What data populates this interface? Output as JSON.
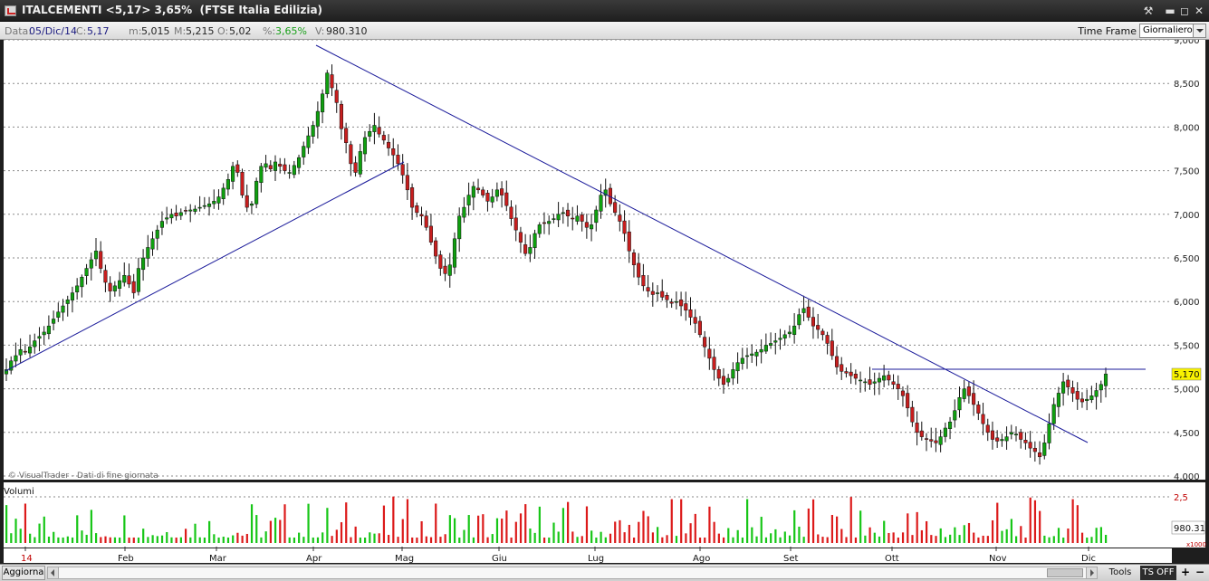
{
  "window": {
    "title": "ITALCEMENTI <5,17> 3,65%  (FTSE Italia Edilizia)",
    "icon": "chart-app-icon",
    "controls": [
      "tools-icon",
      "minimize-icon",
      "maximize-icon",
      "close-icon"
    ]
  },
  "infobar": {
    "date_label": "Data:",
    "date_value": "05/Dic/14",
    "close_label": "C:",
    "close_value": "5,17",
    "min_label": "m:",
    "min_value": "5,015",
    "max_label": "M:",
    "max_value": "5,215",
    "open_label": "O:",
    "open_value": "5,02",
    "pct_label": "%:",
    "pct_value": "3,65%",
    "vol_label": "V:",
    "vol_value": "980.310",
    "timeframe_label": "Time Frame",
    "timeframe_value": "Giornaliero"
  },
  "chart_data": [
    {
      "type": "candlestick",
      "yaxis": [
        "9,000",
        "8,500",
        "8,000",
        "7,500",
        "7,000",
        "6,500",
        "6,000",
        "5,500",
        "5,000",
        "4,500",
        "4,000"
      ],
      "ylim": [
        4.0,
        9.0
      ],
      "last_price": "5,170",
      "watermark": "© VisualTrader - Dati di fine giornata",
      "x_labels": [
        "14",
        "Feb",
        "Mar",
        "Apr",
        "Mag",
        "Giu",
        "Lug",
        "Ago",
        "Set",
        "Ott",
        "Nov",
        "Dic"
      ],
      "closes": [
        5.22,
        5.32,
        5.38,
        5.45,
        5.42,
        5.48,
        5.55,
        5.6,
        5.65,
        5.72,
        5.8,
        5.88,
        5.95,
        6.02,
        6.1,
        6.18,
        6.28,
        6.38,
        6.48,
        6.58,
        6.38,
        6.22,
        6.12,
        6.18,
        6.24,
        6.3,
        6.2,
        6.1,
        6.38,
        6.5,
        6.62,
        6.72,
        6.82,
        6.92,
        6.96,
        7.0,
        6.98,
        7.02,
        7.04,
        7.05,
        7.06,
        7.08,
        7.1,
        7.12,
        7.15,
        7.2,
        7.3,
        7.4,
        7.55,
        7.48,
        7.22,
        7.08,
        7.12,
        7.38,
        7.55,
        7.58,
        7.52,
        7.6,
        7.55,
        7.5,
        7.48,
        7.56,
        7.65,
        7.78,
        7.9,
        8.02,
        8.18,
        8.38,
        8.62,
        8.45,
        8.28,
        7.98,
        7.82,
        7.58,
        7.48,
        7.72,
        7.88,
        7.95,
        8.02,
        7.92,
        7.85,
        7.76,
        7.68,
        7.58,
        7.45,
        7.28,
        7.08,
        7.02,
        6.98,
        6.85,
        6.68,
        6.52,
        6.38,
        6.32,
        6.42,
        6.72,
        6.98,
        7.08,
        7.22,
        7.32,
        7.28,
        7.22,
        7.15,
        7.2,
        7.28,
        7.22,
        7.1,
        6.95,
        6.82,
        6.68,
        6.55,
        6.62,
        6.78,
        6.88,
        6.9,
        6.92,
        6.95,
        7.0,
        7.02,
        6.98,
        6.95,
        6.98,
        6.92,
        6.85,
        6.88,
        7.05,
        7.22,
        7.28,
        7.12,
        7.02,
        6.92,
        6.78,
        6.58,
        6.42,
        6.28,
        6.18,
        6.12,
        6.08,
        6.1,
        6.05,
        6.02,
        5.98,
        6.0,
        5.95,
        5.9,
        5.82,
        5.75,
        5.62,
        5.48,
        5.35,
        5.22,
        5.12,
        5.05,
        5.12,
        5.22,
        5.3,
        5.35,
        5.38,
        5.4,
        5.42,
        5.45,
        5.5,
        5.52,
        5.55,
        5.58,
        5.62,
        5.65,
        5.72,
        5.85,
        5.92,
        5.82,
        5.72,
        5.68,
        5.62,
        5.52,
        5.38,
        5.25,
        5.2,
        5.18,
        5.15,
        5.12,
        5.1,
        5.08,
        5.05,
        5.08,
        5.12,
        5.15,
        5.1,
        5.05,
        5.0,
        4.92,
        4.78,
        4.62,
        4.5,
        4.45,
        4.42,
        4.4,
        4.38,
        4.45,
        4.55,
        4.62,
        4.75,
        4.9,
        5.0,
        4.92,
        4.82,
        4.72,
        4.6,
        4.5,
        4.42,
        4.4,
        4.42,
        4.45,
        4.5,
        4.48,
        4.42,
        4.38,
        4.32,
        4.28,
        4.22,
        4.38,
        4.6,
        4.82,
        4.95,
        5.08,
        5.02,
        4.95,
        4.88,
        4.85,
        4.88,
        4.92,
        4.98,
        5.05,
        5.17
      ]
    },
    {
      "type": "bar",
      "title": "Volumi",
      "yaxis": [
        "2,5"
      ],
      "last_value": "980.31",
      "unit": "x1000"
    }
  ]
}
